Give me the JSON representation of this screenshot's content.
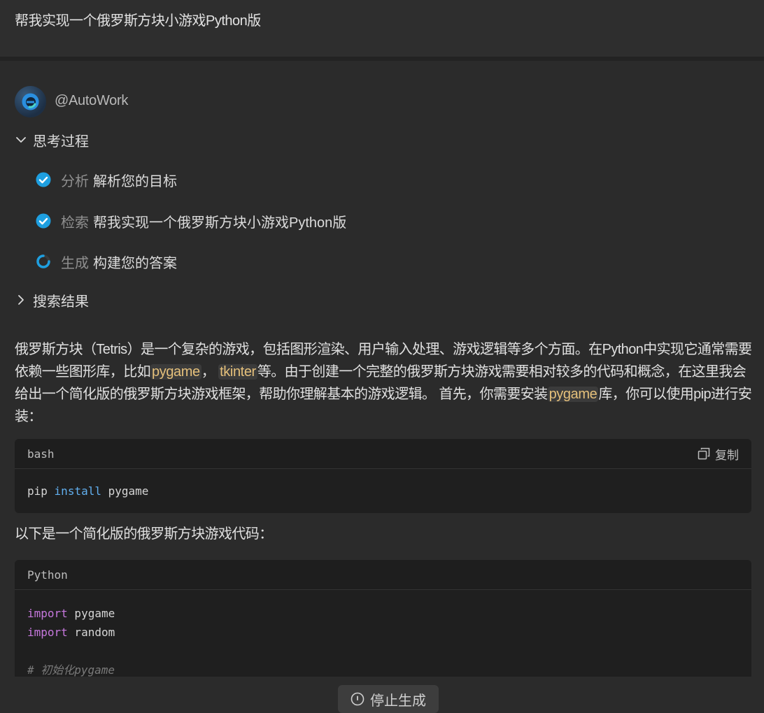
{
  "user_message": "帮我实现一个俄罗斯方块小游戏Python版",
  "agent": {
    "name": "@AutoWork",
    "avatar_icon": "edge-like-logo-icon"
  },
  "thinking": {
    "label": "思考过程",
    "expanded": true,
    "steps": [
      {
        "kind": "分析",
        "desc": "解析您的目标",
        "status": "done",
        "icon": "check-circle-icon"
      },
      {
        "kind": "检索",
        "desc": "帮我实现一个俄罗斯方块小游戏Python版",
        "status": "done",
        "icon": "check-circle-icon"
      },
      {
        "kind": "生成",
        "desc": "构建您的答案",
        "status": "loading",
        "icon": "spinner-icon"
      }
    ]
  },
  "search_results": {
    "label": "搜索结果",
    "expanded": false
  },
  "answer": {
    "para1_a": "俄罗斯方块（Tetris）是一个复杂的游戏，包括图形渲染、用户输入处理、游戏逻辑等多个方面。在Python中实现它通常需要依赖一些图形库，比如",
    "code_pygame": "pygame",
    "sep": "，",
    "code_tkinter": "tkinter",
    "para1_b": "等。由于创建一个完整的俄罗斯方块游戏需要相对较多的代码和概念，在这里我会给出一个简化版的俄罗斯方块游戏框架，帮助你理解基本的游戏逻辑。 首先，你需要安装",
    "code_pygame2": "pygame",
    "para1_c": "库，你可以使用pip进行安装：",
    "code1": {
      "lang": "bash",
      "copy_label": "复制",
      "tokens": [
        "pip",
        "install",
        "pygame"
      ]
    },
    "para2": "以下是一个简化版的俄罗斯方块游戏代码：",
    "code2": {
      "lang": "Python",
      "lines": [
        {
          "kw": "import",
          "rest": " pygame"
        },
        {
          "kw": "import",
          "rest": " random"
        }
      ],
      "comment": "# 初始化pygame"
    }
  },
  "stop_button": {
    "label": "停止生成",
    "icon": "stop-circle-icon"
  },
  "colors": {
    "accent": "#1e9fe0",
    "inline_code": "#e5c07b",
    "keyword": "#c678dd",
    "command": "#61afef"
  }
}
